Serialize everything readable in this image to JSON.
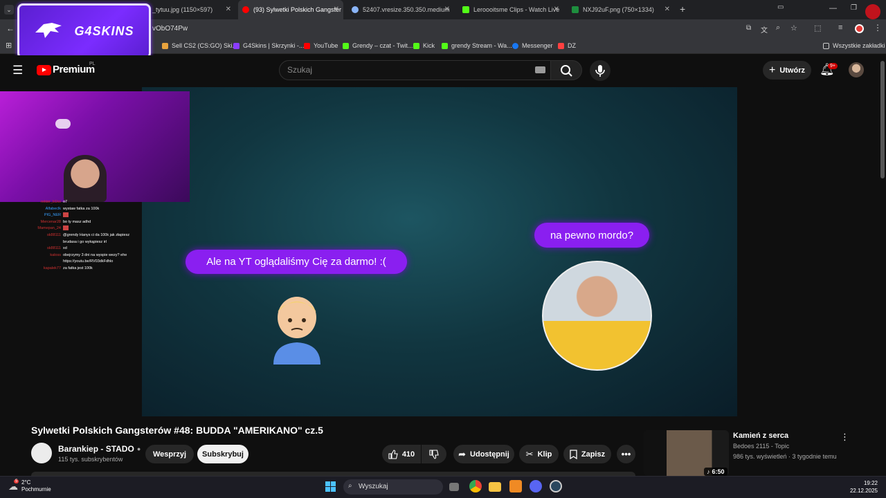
{
  "browser": {
    "tabs": [
      {
        "title": "_tytuu.jpg (1150×597)",
        "favicon_color": "#5f6368"
      },
      {
        "title": "(93) Sylwetki Polskich Gangster",
        "favicon_color": "#ff0000",
        "active": true
      },
      {
        "title": "52407.vresize.350.350.medium",
        "favicon_color": "#8ab4f8"
      },
      {
        "title": "Leroooitsme Clips - Watch Live",
        "favicon_color": "#53fc18"
      },
      {
        "title": "NXJ92uF.png (750×1334)",
        "favicon_color": "#1e8e3e"
      }
    ],
    "new_tab_label": "+",
    "url": "vObO74Pw",
    "bookmarks": [
      {
        "label": "Sell CS2 (CS:GO) Ski...",
        "color": "#e8a33d"
      },
      {
        "label": "G4Skins | Skrzynki -...",
        "color": "#8a3cff"
      },
      {
        "label": "YouTube",
        "color": "#ff0000"
      },
      {
        "label": "Grendy – czat - Twit...",
        "color": "#53fc18"
      },
      {
        "label": "Kick",
        "color": "#53fc18"
      },
      {
        "label": "grendy Stream - Wa...",
        "color": "#53fc18"
      },
      {
        "label": "Messenger",
        "color": "#1877f2"
      },
      {
        "label": "DZ",
        "color": "#ff4040"
      }
    ],
    "all_bookmarks": "Wszystkie zakładki"
  },
  "overlay": {
    "logo_text": "G4SKINS"
  },
  "youtube": {
    "logo_text": "Premium",
    "region": "PL",
    "search_placeholder": "Szukaj",
    "create_label": "Utwórz",
    "notifications_badge": "9+"
  },
  "video_content": {
    "bubble_left": "Ale na YT oglądaliśmy Cię za darmo! :(",
    "bubble_right": "na pewno mordo?"
  },
  "chat": [
    {
      "user": "rekter_b1ko",
      "msg": "o7",
      "color": "#d03030"
    },
    {
      "user": "Alfabeclk",
      "msg": "wystaw fatka za 100k",
      "color": "#39a0ff"
    },
    {
      "user": "PIG_NER",
      "msg": "",
      "color": "#39a0ff"
    },
    {
      "user": "Mercenar28",
      "msg": "bo ty masz adhd",
      "color": "#d03030"
    },
    {
      "user": "Mamepan_24",
      "msg": "",
      "color": "#d03030"
    },
    {
      "user": "sk88111",
      "msg": "@grendy Hanys ci da 100k jak złapiesz",
      "color": "#d03030"
    },
    {
      "user": "",
      "msg": "brudasa i go wykąpiesz irl",
      "color": "#d03030"
    },
    {
      "user": "sk88111",
      "msg": "xd",
      "color": "#d03030"
    },
    {
      "user": "kaloss",
      "msg": "obejrzymy 3 dni na wyspie wezy? ehe",
      "color": "#d03030"
    },
    {
      "user": "",
      "msg": "https://youtu.be/RV03dkFdhlo",
      "color": "#d03030"
    },
    {
      "user": "kapalek77",
      "msg": "za fatka jest 100k",
      "color": "#d03030"
    }
  ],
  "video": {
    "title": "Sylwetki Polskich Gangsterów #48: BUDDA \"AMERIKANO\" cz.5",
    "channel": "Barankiep - STADO",
    "subscribers": "115 tys. subskrybentów",
    "support_label": "Wesprzyj",
    "subscribe_label": "Subskrybuj",
    "likes": "410",
    "share_label": "Udostępnij",
    "clip_label": "Klip",
    "save_label": "Zapisz"
  },
  "sidebar_video": {
    "title": "Kamień z serca",
    "channel": "Bedoes 2115 - Topic",
    "meta": "986 tys. wyświetleń · 3 tygodnie temu",
    "duration": "6:50"
  },
  "taskbar": {
    "weather_temp": "2°C",
    "weather_desc": "Pochmurnie",
    "weather_badge": "5",
    "search_label": "Wyszukaj",
    "time": "19:22",
    "date": "22.12.2025"
  }
}
